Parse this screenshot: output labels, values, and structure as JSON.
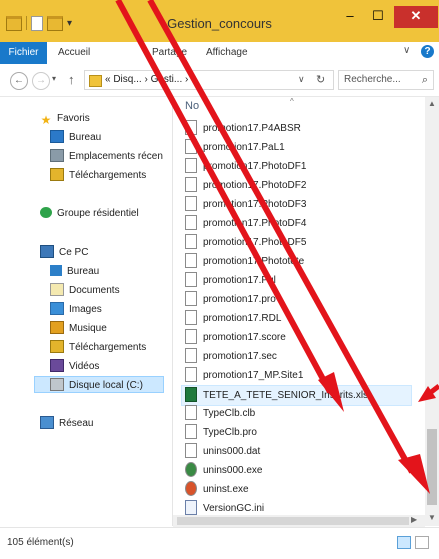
{
  "window": {
    "title": "Gestion_concours"
  },
  "window_buttons": {
    "minimize": "–",
    "maximize": "☐",
    "close": "✕"
  },
  "ribbon": {
    "tabs": [
      "Fichier",
      "Accueil",
      "Partage",
      "Affichage"
    ],
    "help": "?",
    "expand": "∨"
  },
  "navigation": {
    "back": "←",
    "forward": "→",
    "up": "↑",
    "recent": "▾",
    "address": "« Disq... › Gesti... ›",
    "address_dropdown": "∨",
    "refresh": "↻",
    "search_placeholder": "Recherche...",
    "search_icon": "⌕"
  },
  "sidebar": {
    "items": [
      {
        "label": "Favoris",
        "icon": "star-icon"
      },
      {
        "label": "Bureau",
        "icon": "desktop-icon"
      },
      {
        "label": "Emplacements récen",
        "icon": "recent-places-icon"
      },
      {
        "label": "Téléchargements",
        "icon": "downloads-icon"
      },
      {
        "label": "Groupe résidentiel",
        "icon": "homegroup-icon"
      },
      {
        "label": "Ce PC",
        "icon": "computer-icon"
      },
      {
        "label": "Bureau",
        "icon": "desktop-icon"
      },
      {
        "label": "Documents",
        "icon": "documents-icon"
      },
      {
        "label": "Images",
        "icon": "pictures-icon"
      },
      {
        "label": "Musique",
        "icon": "music-icon"
      },
      {
        "label": "Téléchargements",
        "icon": "downloads-icon"
      },
      {
        "label": "Vidéos",
        "icon": "videos-icon"
      },
      {
        "label": "Disque local (C:)",
        "icon": "local-disk-icon"
      },
      {
        "label": "Réseau",
        "icon": "network-icon"
      }
    ]
  },
  "filelist": {
    "column_header": "No",
    "sort_indicator": "^",
    "files": [
      "promotion17.P4ABSR",
      "promotion17.PaL1",
      "promotion17.PhotoDF1",
      "promotion17.PhotoDF2",
      "promotion17.PhotoDF3",
      "promotion17.PhotoDF4",
      "promotion17.PhotoDF5",
      "promotion17.Phototete",
      "promotion17.Pql",
      "promotion17.pro",
      "promotion17.RDL",
      "promotion17.score",
      "promotion17.sec",
      "promotion17_MP.Site1",
      "TETE_A_TETE_SENIOR_Inscrits.xls",
      "TypeClb.clb",
      "TypeClb.pro",
      "unins000.dat",
      "unins000.exe",
      "uninst.exe",
      "VersionGC.ini"
    ],
    "selected": "TETE_A_TETE_SENIOR_Inscrits.xls"
  },
  "statusbar": {
    "item_count": "105 élément(s)"
  },
  "colors": {
    "titlebar": "#f0c33a",
    "file_tab": "#1979ca",
    "close": "#c9302c",
    "annotation_arrow": "#e3141b"
  }
}
